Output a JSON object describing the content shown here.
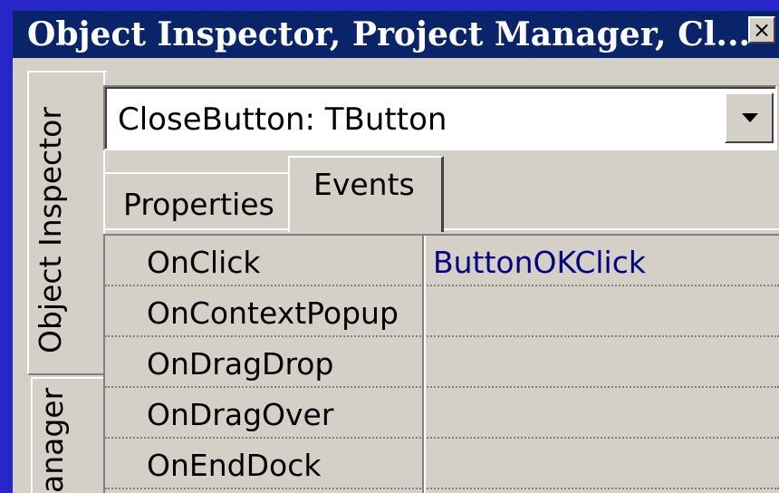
{
  "window": {
    "title": "Object Inspector, Project Manager, Cl...",
    "close_icon": "×"
  },
  "side_tabs": [
    {
      "label": "Object Inspector",
      "active": true
    },
    {
      "label": "anager",
      "active": false
    }
  ],
  "component_selector": {
    "value": "CloseButton: TButton"
  },
  "tabs": [
    {
      "label": "Properties",
      "active": false
    },
    {
      "label": "Events",
      "active": true
    }
  ],
  "events": [
    {
      "name": "OnClick",
      "value": "ButtonOKClick"
    },
    {
      "name": "OnContextPopup",
      "value": ""
    },
    {
      "name": "OnDragDrop",
      "value": ""
    },
    {
      "name": "OnDragOver",
      "value": ""
    },
    {
      "name": "OnEndDock",
      "value": ""
    }
  ],
  "colors": {
    "titlebar": "#0a246a",
    "background": "#2727c8",
    "face": "#d4d0c8",
    "event_value": "#000080"
  }
}
